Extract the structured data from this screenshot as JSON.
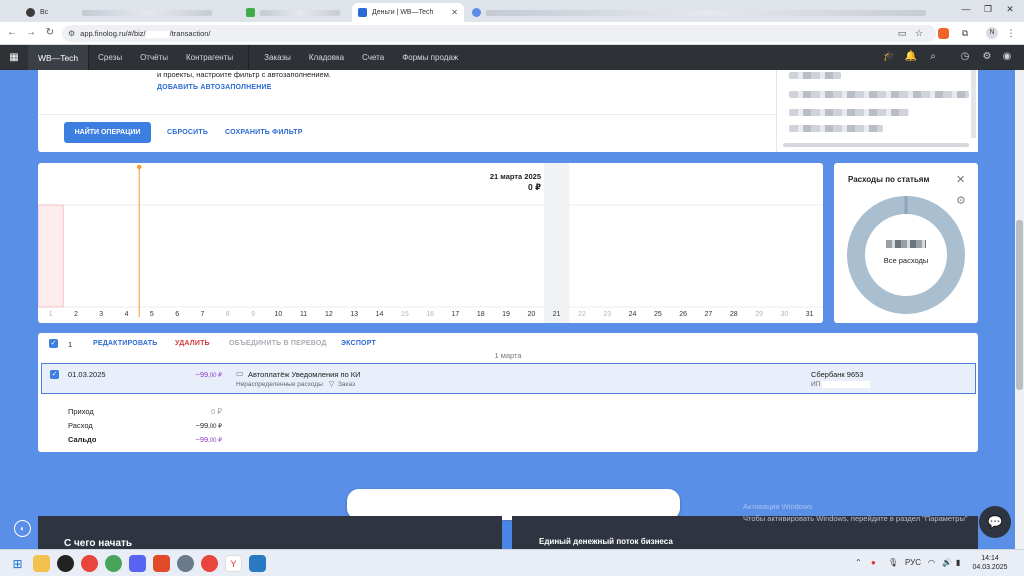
{
  "browser": {
    "tabs": [
      {
        "label": "Вс",
        "state": "inactive"
      },
      {
        "label": "",
        "state": "inactive"
      },
      {
        "label": "",
        "state": "inactive"
      },
      {
        "label": "Деньги | WB—Tech",
        "state": "active"
      },
      {
        "label": "",
        "state": "inactive"
      }
    ],
    "url_prefix": "app.finolog.ru/#/biz/",
    "url_suffix": "/transaction/",
    "profile_initial": "N"
  },
  "app_nav": {
    "brand": "WB—Tech",
    "items": [
      "Срезы",
      "Отчёты",
      "Контрагенты",
      "Заказы",
      "Кладовка",
      "Счета",
      "Формы продаж"
    ]
  },
  "filter": {
    "hint_text": "и проекты, настроите фильтр с автозаполнением.",
    "autofill_link": "ДОБАВИТЬ АВТОЗАПОЛНЕНИЕ",
    "find_button": "НАЙТИ ОПЕРАЦИИ",
    "reset_button": "СБРОСИТЬ",
    "save_filter_button": "СОХРАНИТЬ ФИЛЬТР"
  },
  "chart_data": {
    "type": "bar",
    "title": "",
    "categories": [
      "1",
      "2",
      "3",
      "4",
      "5",
      "6",
      "7",
      "8",
      "9",
      "10",
      "11",
      "12",
      "13",
      "14",
      "15",
      "16",
      "17",
      "18",
      "19",
      "20",
      "21",
      "22",
      "23",
      "24",
      "25",
      "26",
      "27",
      "28",
      "29",
      "30",
      "31"
    ],
    "values": [
      99,
      0,
      0,
      0,
      0,
      0,
      0,
      0,
      0,
      0,
      0,
      0,
      0,
      0,
      0,
      0,
      0,
      0,
      0,
      0,
      0,
      0,
      0,
      0,
      0,
      0,
      0,
      0,
      0,
      0,
      0
    ],
    "dim_categories": [
      "1",
      "8",
      "9",
      "15",
      "16",
      "22",
      "23",
      "29",
      "30"
    ],
    "highlight_category": "21",
    "tooltip": {
      "date": "21 марта 2025",
      "value": "0 ₽"
    },
    "xlabel": "",
    "ylabel": "",
    "grid": true
  },
  "expenses_widget": {
    "title": "Расходы по статьям",
    "center_label": "Все расходы",
    "ring_color": "#a9bfcf"
  },
  "table": {
    "selected_count": "1",
    "actions": {
      "edit": "РЕДАКТИРОВАТЬ",
      "delete": "УДАЛИТЬ",
      "merge": "ОБЪЕДИНИТЬ В ПЕРЕВОД",
      "export": "ЭКСПОРТ"
    },
    "day_label": "1 марта",
    "row": {
      "date": "01.03.2025",
      "amount_main": "−99",
      "amount_cents": ",00 ₽",
      "description": "Автоплатёж Уведомления по КИ",
      "category": "Нераспределенные расходы",
      "tag": "Заказ",
      "account": "Сбербанк 9653",
      "counterparty_prefix": "ИП"
    },
    "summary": {
      "income_label": "Приход",
      "income_value": "0 ₽",
      "expense_label": "Расход",
      "expense_main": "−99",
      "expense_cents": ",00 ₽",
      "balance_label": "Сальдо",
      "balance_main": "−99",
      "balance_cents": ",00 ₽"
    }
  },
  "footer": {
    "left_title": "С чего начать",
    "right_title": "Единый денежный поток бизнеса"
  },
  "windows_watermark": {
    "line1": "Активация Windows",
    "line2": "Чтобы активировать Windows, перейдите в раздел \"Параметры\""
  },
  "taskbar": {
    "lang": "РУС",
    "time": "14:14",
    "date": "04.03.2025"
  }
}
